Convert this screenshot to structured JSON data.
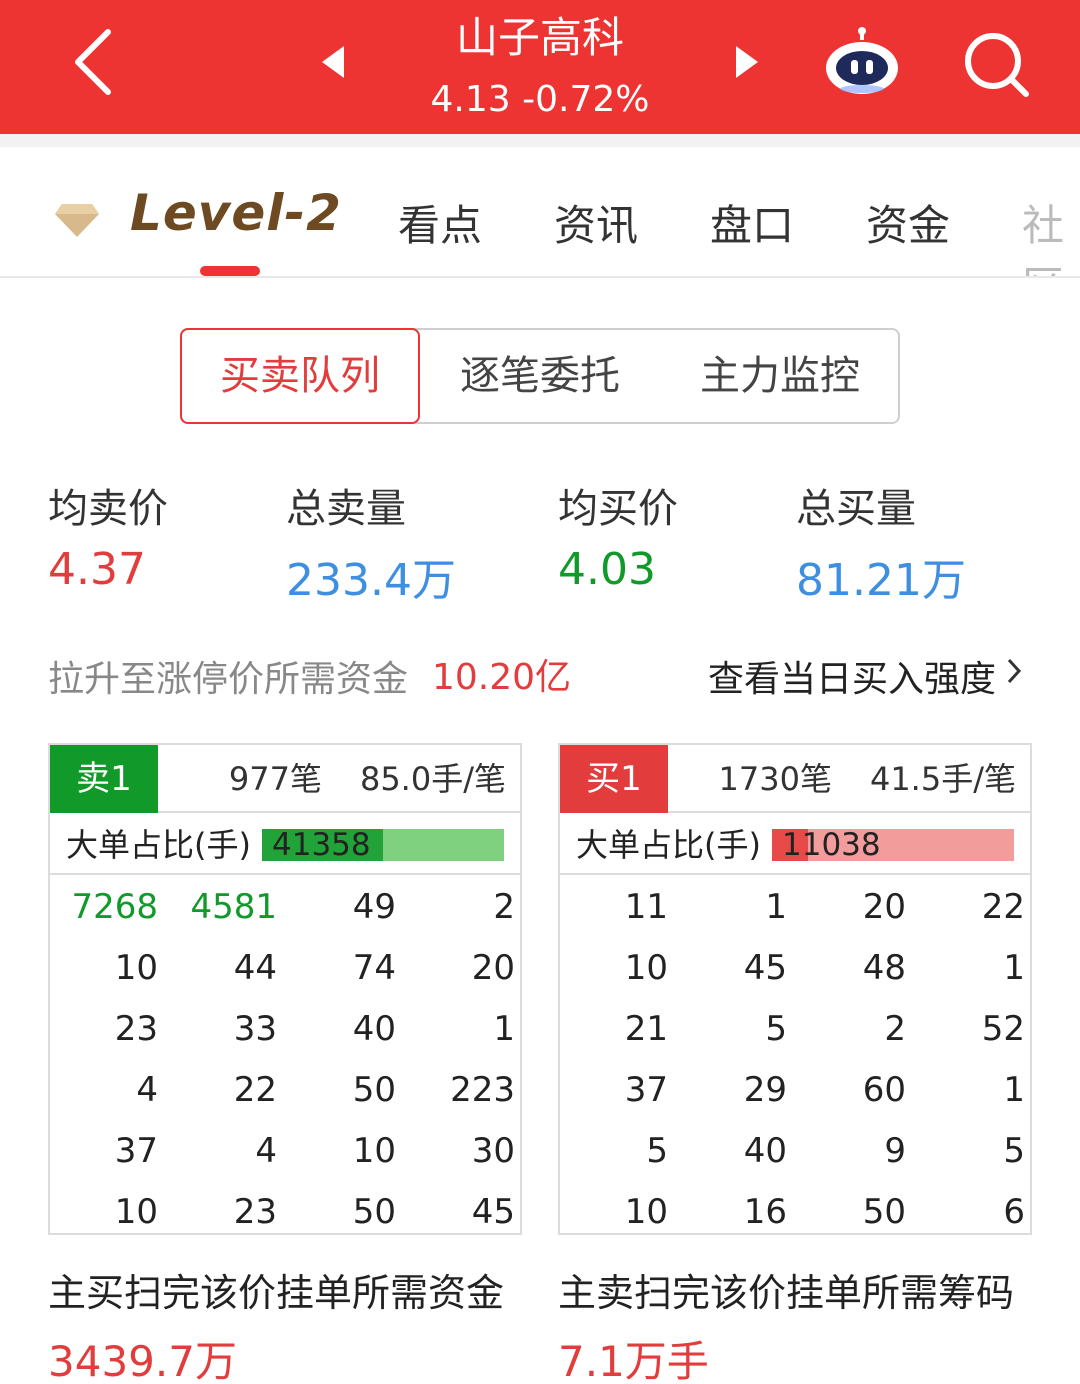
{
  "header": {
    "title": "山子高科",
    "subtitle": "4.13 -0.72%",
    "colors": {
      "bg": "#ee3333",
      "fg": "#ffffff"
    },
    "icons": [
      "back-icon",
      "prev-stock-icon",
      "next-stock-icon",
      "robot-assistant-icon",
      "search-icon"
    ]
  },
  "tabs": {
    "level2": "Level-2",
    "items": [
      "看点",
      "资讯",
      "盘口",
      "资金",
      "社区"
    ],
    "active": "Level-2"
  },
  "segments": {
    "items": [
      "买卖队列",
      "逐笔委托",
      "主力监控"
    ],
    "active": 0
  },
  "stats": [
    {
      "label": "均卖价",
      "value": "4.37",
      "color": "#e23c3c"
    },
    {
      "label": "总卖量",
      "value": "233.4万",
      "color": "#3e8fe2"
    },
    {
      "label": "均买价",
      "value": "4.03",
      "color": "#11992a"
    },
    {
      "label": "总买量",
      "value": "81.21万",
      "color": "#3e8fe2"
    }
  ],
  "limit_up": {
    "label": "拉升至涨停价所需资金",
    "value": "10.20亿",
    "link": "查看当日买入强度"
  },
  "sell_panel": {
    "badge": "卖1",
    "count": "977笔",
    "avg": "85.0手/笔",
    "ratio_label": "大单占比(手)",
    "ratio_value": "41358",
    "ratio_fraction": 0.5,
    "rows": [
      [
        "7268",
        "4581",
        "49",
        "2"
      ],
      [
        "10",
        "44",
        "74",
        "20"
      ],
      [
        "23",
        "33",
        "40",
        "1"
      ],
      [
        "4",
        "22",
        "50",
        "223"
      ],
      [
        "37",
        "4",
        "10",
        "30"
      ],
      [
        "10",
        "23",
        "50",
        "45"
      ]
    ],
    "highlight": [
      [
        0,
        0
      ],
      [
        0,
        1
      ]
    ]
  },
  "buy_panel": {
    "badge": "买1",
    "count": "1730笔",
    "avg": "41.5手/笔",
    "ratio_label": "大单占比(手)",
    "ratio_value": "11038",
    "ratio_fraction": 0.15,
    "rows": [
      [
        "11",
        "1",
        "20",
        "22"
      ],
      [
        "10",
        "45",
        "48",
        "1"
      ],
      [
        "21",
        "5",
        "2",
        "52"
      ],
      [
        "37",
        "29",
        "60",
        "1"
      ],
      [
        "5",
        "40",
        "9",
        "5"
      ],
      [
        "10",
        "16",
        "50",
        "6"
      ]
    ]
  },
  "footer": {
    "buy_label": "主买扫完该价挂单所需资金",
    "buy_value": "3439.7万",
    "sell_label": "主卖扫完该价挂单所需筹码",
    "sell_value": "7.1万手"
  }
}
